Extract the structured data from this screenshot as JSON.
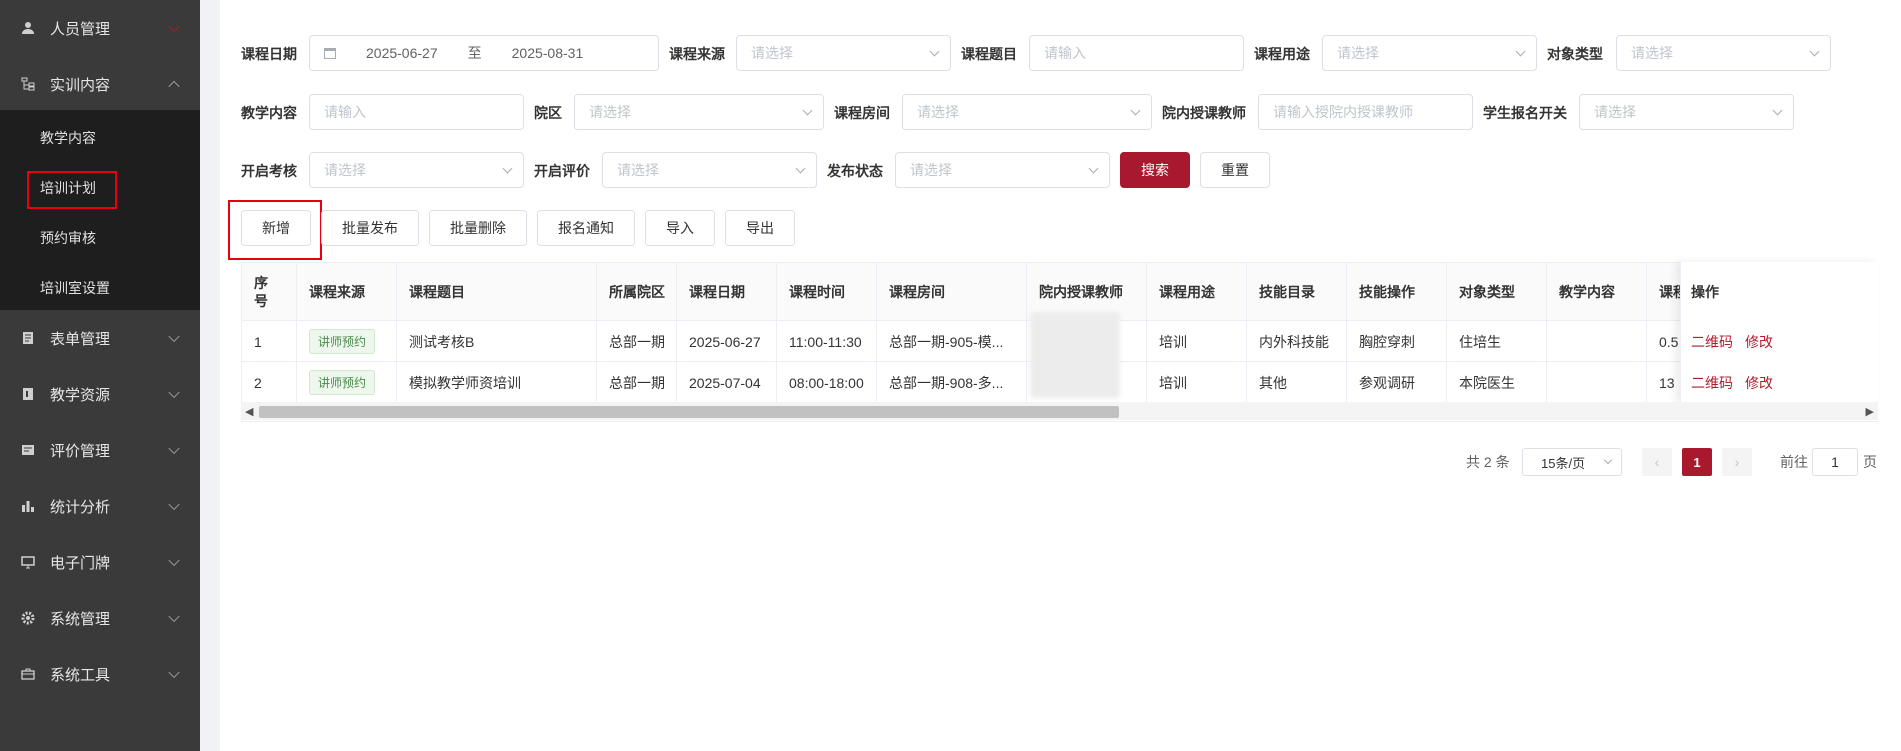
{
  "sidebar": {
    "items": [
      {
        "label": "人员管理",
        "icon": "person-icon"
      },
      {
        "label": "实训内容",
        "icon": "tree-icon"
      },
      {
        "label": "表单管理",
        "icon": "form-icon"
      },
      {
        "label": "教学资源",
        "icon": "resource-icon"
      },
      {
        "label": "评价管理",
        "icon": "evaluation-icon"
      },
      {
        "label": "统计分析",
        "icon": "bar-chart-icon"
      },
      {
        "label": "电子门牌",
        "icon": "monitor-icon"
      },
      {
        "label": "系统管理",
        "icon": "gear-icon"
      },
      {
        "label": "系统工具",
        "icon": "toolbox-icon"
      }
    ],
    "submenu": [
      "教学内容",
      "培训计划",
      "预约审核",
      "培训室设置"
    ]
  },
  "filters": {
    "course_date": {
      "label": "课程日期",
      "start": "2025-06-27",
      "sep": "至",
      "end": "2025-08-31"
    },
    "course_source": {
      "label": "课程来源",
      "placeholder": "请选择"
    },
    "course_title": {
      "label": "课程题目",
      "placeholder": "请输入"
    },
    "course_purpose": {
      "label": "课程用途",
      "placeholder": "请选择"
    },
    "target_type": {
      "label": "对象类型",
      "placeholder": "请选择"
    },
    "teaching_content": {
      "label": "教学内容",
      "placeholder": "请输入"
    },
    "campus": {
      "label": "院区",
      "placeholder": "请选择"
    },
    "course_room": {
      "label": "课程房间",
      "placeholder": "请选择"
    },
    "internal_teacher": {
      "label": "院内授课教师",
      "placeholder": "请输入授院内授课教师"
    },
    "enroll_switch": {
      "label": "学生报名开关",
      "placeholder": "请选择"
    },
    "open_exam": {
      "label": "开启考核",
      "placeholder": "请选择"
    },
    "open_eval": {
      "label": "开启评价",
      "placeholder": "请选择"
    },
    "publish_status": {
      "label": "发布状态",
      "placeholder": "请选择"
    },
    "search_label": "搜索",
    "reset_label": "重置"
  },
  "toolbar": {
    "add": "新增",
    "batch_publish": "批量发布",
    "batch_delete": "批量删除",
    "enroll_notice": "报名通知",
    "import": "导入",
    "export": "导出"
  },
  "table": {
    "headers": [
      "序号",
      "课程来源",
      "课程题目",
      "所属院区",
      "课程日期",
      "课程时间",
      "课程房间",
      "院内授课教师",
      "课程用途",
      "技能目录",
      "技能操作",
      "对象类型",
      "教学内容",
      "课程",
      "操作"
    ],
    "rows": [
      {
        "no": "1",
        "source": "讲师预约",
        "title": "测试考核B",
        "campus": "总部一期",
        "date": "2025-06-27",
        "time": "11:00-11:30",
        "room": "总部一期-905-模...",
        "teacher": "",
        "purpose": "培训",
        "skill_cat": "内外科技能",
        "skill_op": "胸腔穿刺",
        "target": "住培生",
        "content": "",
        "course": "0.5",
        "op1": "二维码",
        "op2": "修改"
      },
      {
        "no": "2",
        "source": "讲师预约",
        "title": "模拟教学师资培训",
        "campus": "总部一期",
        "date": "2025-07-04",
        "time": "08:00-18:00",
        "room": "总部一期-908-多...",
        "teacher": "",
        "purpose": "培训",
        "skill_cat": "其他",
        "skill_op": "参观调研",
        "target": "本院医生",
        "content": "",
        "course": "13",
        "op1": "二维码",
        "op2": "修改"
      }
    ]
  },
  "pagination": {
    "total": "共 2 条",
    "page_size": "15条/页",
    "current": "1",
    "goto_prefix": "前往",
    "goto_value": "1",
    "goto_suffix": "页"
  }
}
